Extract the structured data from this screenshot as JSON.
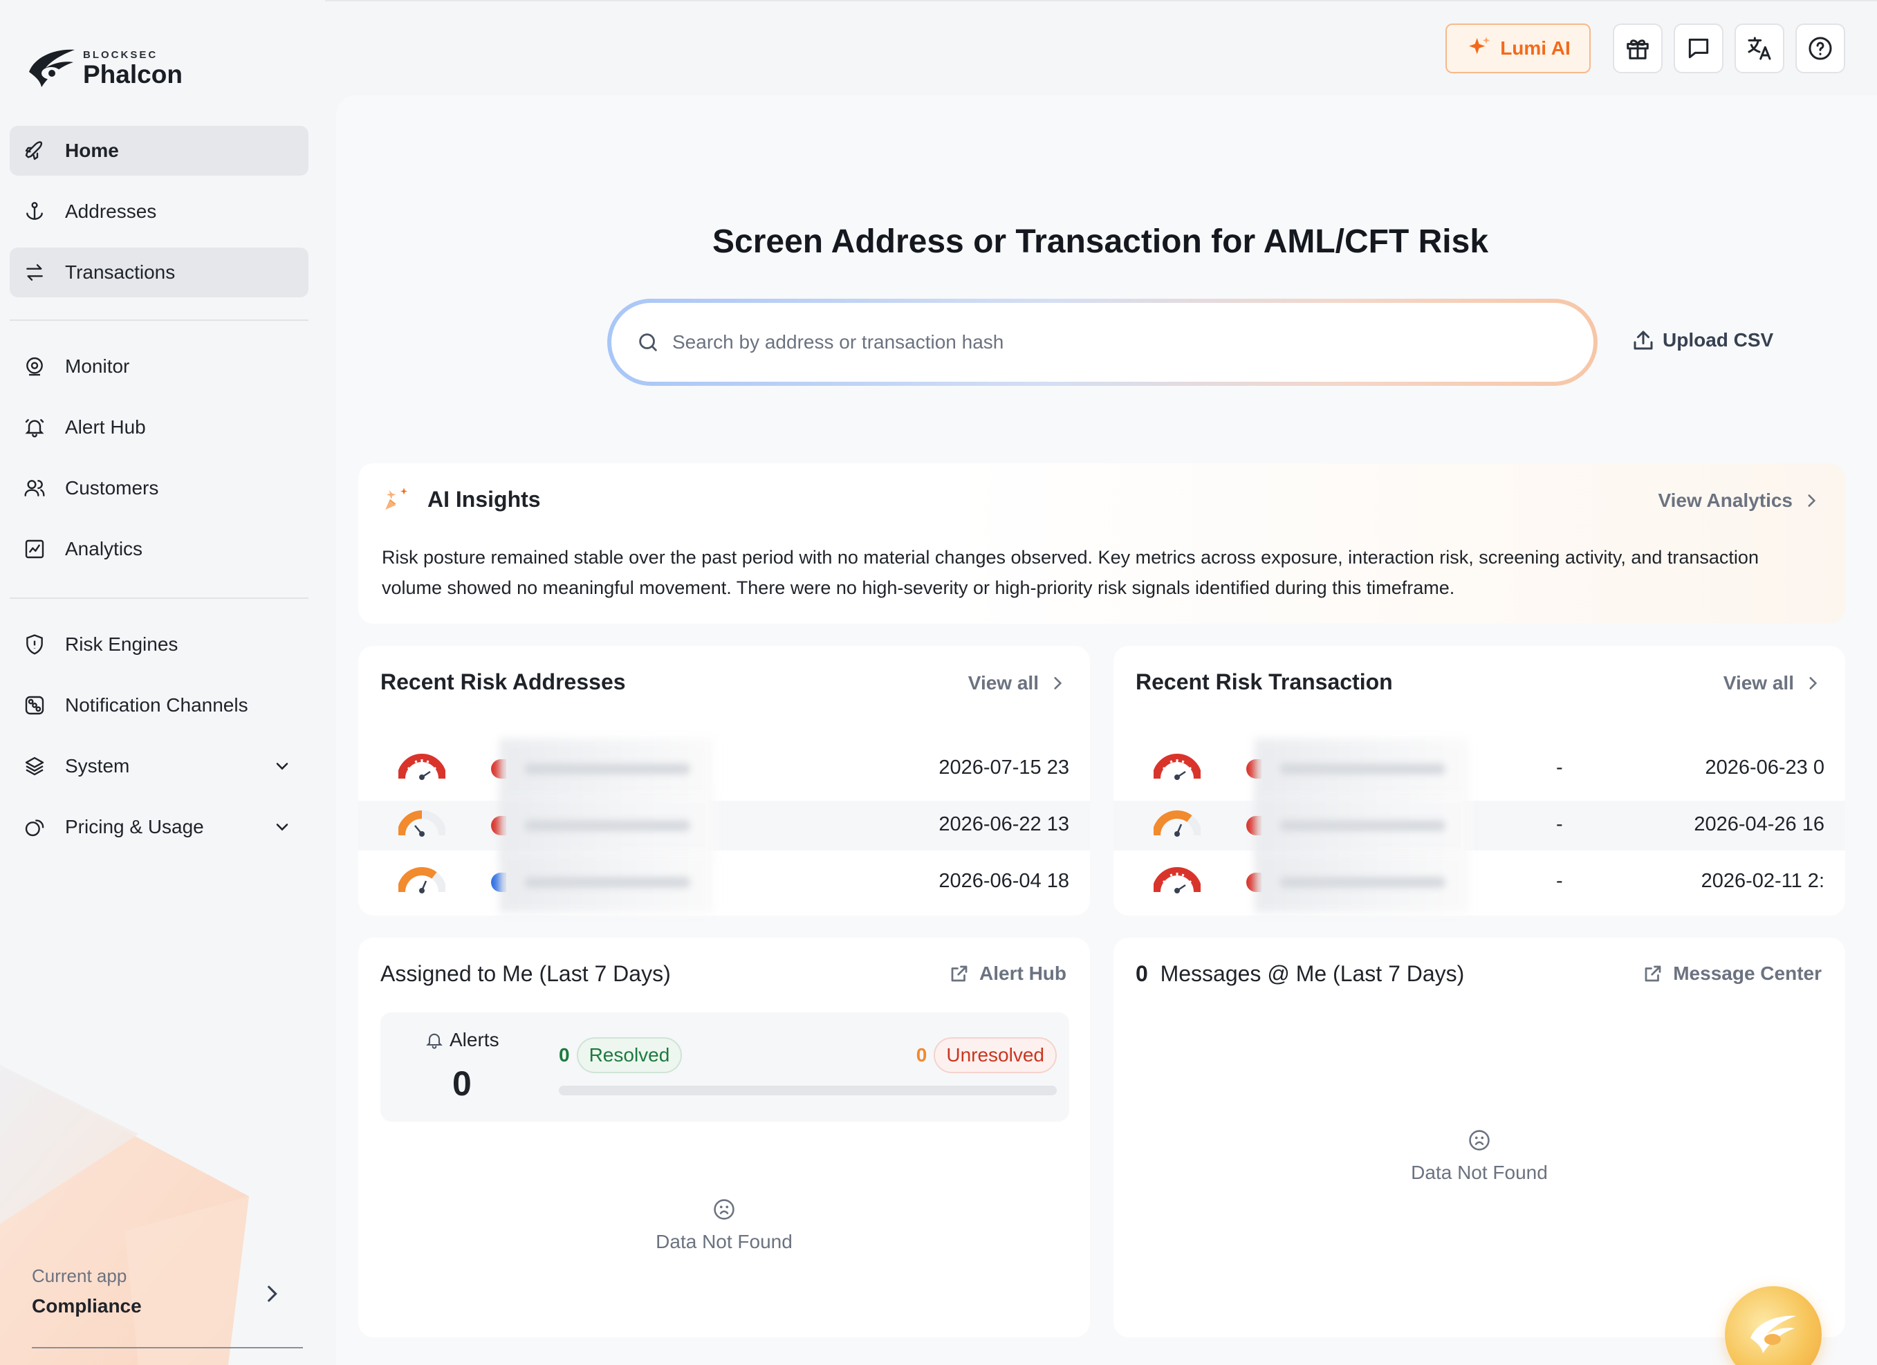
{
  "brand": {
    "sub": "BLOCKSEC",
    "name": "Phalcon"
  },
  "sidebar": {
    "items": [
      {
        "label": "Home",
        "icon": "rocket-icon",
        "active": true
      },
      {
        "label": "Addresses",
        "icon": "anchor-icon",
        "active": false
      },
      {
        "label": "Transactions",
        "icon": "swap-icon",
        "active": true
      },
      {
        "label": "Monitor",
        "icon": "monitor-icon",
        "active": false
      },
      {
        "label": "Alert Hub",
        "icon": "bell-icon",
        "active": false
      },
      {
        "label": "Customers",
        "icon": "users-icon",
        "active": false
      },
      {
        "label": "Analytics",
        "icon": "analytics-icon",
        "active": false
      },
      {
        "label": "Risk Engines",
        "icon": "shield-icon",
        "active": false
      },
      {
        "label": "Notification Channels",
        "icon": "channels-icon",
        "active": false
      },
      {
        "label": "System",
        "icon": "layers-icon",
        "active": false
      },
      {
        "label": "Pricing & Usage",
        "icon": "coins-icon",
        "active": false
      }
    ],
    "current_app_caption": "Current app",
    "current_app": "Compliance"
  },
  "topbar": {
    "lumi_label": "Lumi AI",
    "icons": [
      "gift-icon",
      "message-icon",
      "translate-icon",
      "help-icon"
    ]
  },
  "hero": {
    "title": "Screen Address or Transaction for AML/CFT Risk",
    "search_placeholder": "Search by address or transaction hash",
    "upload_label": "Upload CSV"
  },
  "insights": {
    "title": "AI Insights",
    "link": "View Analytics",
    "body": "Risk posture remained stable over the past period with no material changes observed. Key metrics across exposure, interaction risk, screening activity, and transaction volume showed no meaningful movement. There were no high-severity or high-priority risk signals identified during this timeframe."
  },
  "recent_addresses": {
    "title": "Recent Risk Addresses",
    "link": "View all",
    "rows": [
      {
        "date": "2026-07-15 23",
        "level": "high"
      },
      {
        "date": "2026-06-22 13",
        "level": "medium"
      },
      {
        "date": "2026-06-04 18",
        "level": "medium-high"
      }
    ]
  },
  "recent_transactions": {
    "title": "Recent Risk Transaction",
    "link": "View all",
    "rows": [
      {
        "value": "-",
        "date": "2026-06-23 0",
        "level": "high"
      },
      {
        "value": "-",
        "date": "2026-04-26 16",
        "level": "medium-high"
      },
      {
        "value": "-",
        "date": "2026-02-11 2:",
        "level": "high"
      }
    ]
  },
  "assigned": {
    "title": "Assigned to Me (Last 7 Days)",
    "link": "Alert Hub",
    "alerts_label": "Alerts",
    "alerts_count": "0",
    "resolved_count": "0",
    "resolved_label": "Resolved",
    "unresolved_count": "0",
    "unresolved_label": "Unresolved",
    "resolved_progress": 0,
    "empty_text": "Data Not Found"
  },
  "messages": {
    "count": "0",
    "title": "Messages @ Me (Last 7 Days)",
    "link": "Message Center",
    "empty_text": "Data Not Found"
  },
  "colors": {
    "accent_orange": "#f26a1b",
    "risk_red": "#d9342b",
    "risk_orange": "#f28a2e",
    "chain_blue": "#2f6fe4",
    "resolved_green": "#1d7a3e"
  }
}
